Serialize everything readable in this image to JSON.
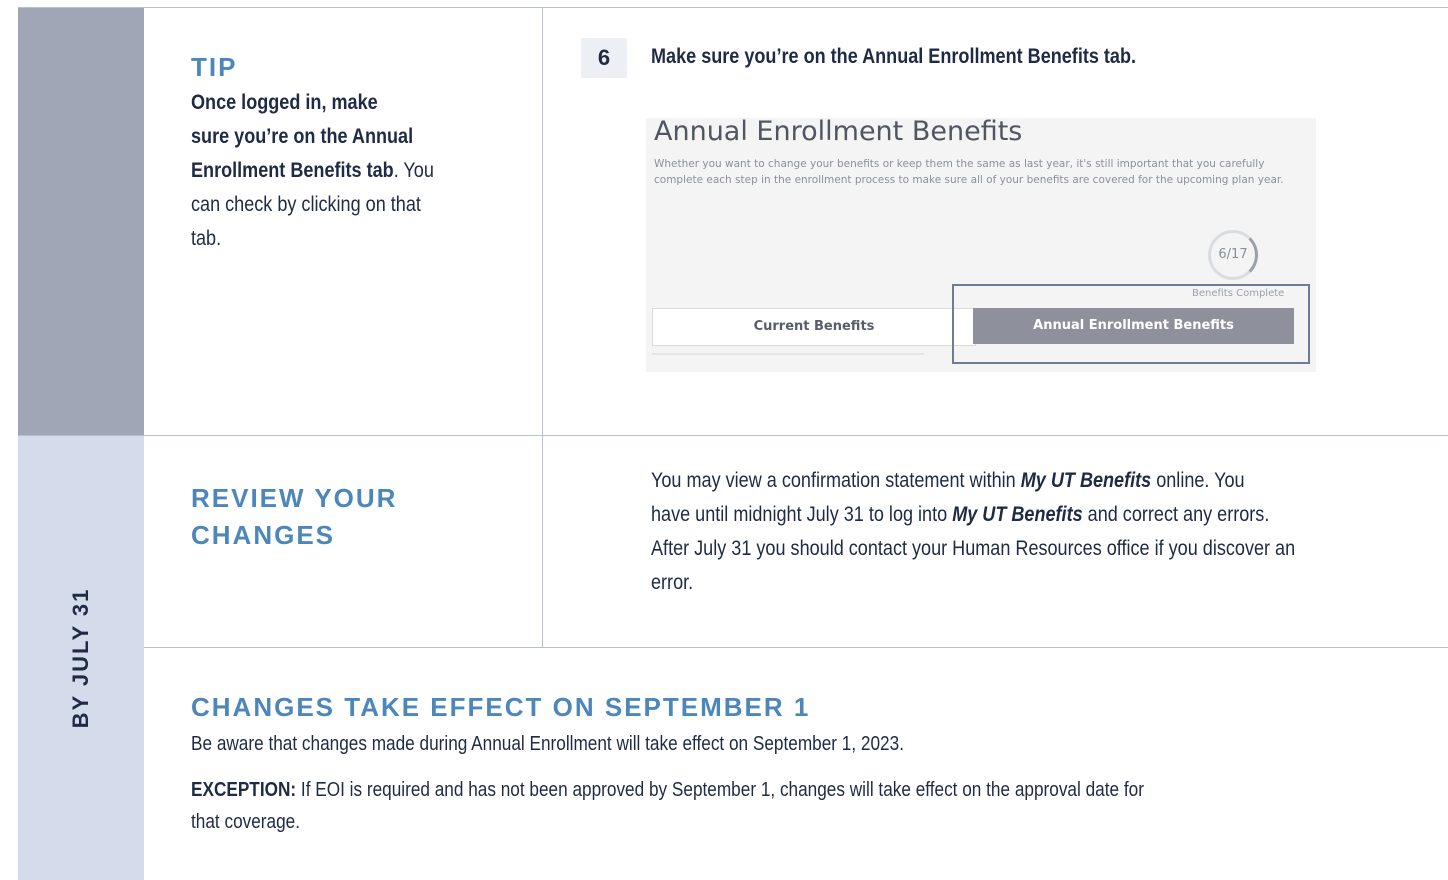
{
  "sidebar": {
    "bottom_label": "BY JULY 31"
  },
  "tip": {
    "heading": "TIP",
    "lines": [
      "Once logged in, make",
      "sure you’re on the Annual",
      "Enrollment Benefits tab",
      ". You",
      "can check by clicking on that",
      "tab."
    ]
  },
  "step6": {
    "number": "6",
    "instruction": "Make sure you’re on the Annual Enrollment Benefits tab."
  },
  "screenshot": {
    "title": "Annual Enrollment Benefits",
    "description": "Whether you want to change your benefits or keep them the same as last year, it's still important that you carefully complete each step in the enrollment process to make sure all of your benefits are covered for the upcoming plan year.",
    "progress": "6/17",
    "progress_fraction": 0.353,
    "progress_label": "Benefits Complete",
    "tab_current": "Current Benefits",
    "tab_annual": "Annual Enrollment Benefits"
  },
  "review": {
    "heading_line1": "REVIEW YOUR",
    "heading_line2": "CHANGES",
    "lines": [
      [
        "You may view a confirmation statement within ",
        "My UT Benefits",
        " online. You"
      ],
      [
        "have until midnight July 31 to log into ",
        "My UT Benefits",
        " and correct any errors."
      ],
      [
        "After July 31 you should contact your Human Resources office if you discover an"
      ],
      [
        "error."
      ]
    ]
  },
  "changes": {
    "heading": "CHANGES TAKE EFFECT ON SEPTEMBER 1",
    "line1": "Be aware that changes made during Annual Enrollment will take effect on September 1, 2023.",
    "exception_label": "EXCEPTION:",
    "exception_text": " If EOI is required and has not been approved by September 1, changes will take effect on the approval date for",
    "exception_text2": "that coverage."
  },
  "colors": {
    "sidebar_top": "#a1a6b6",
    "sidebar_bottom": "#d4dcec",
    "heading": "#4d86bb",
    "text": "#1f2a44"
  }
}
